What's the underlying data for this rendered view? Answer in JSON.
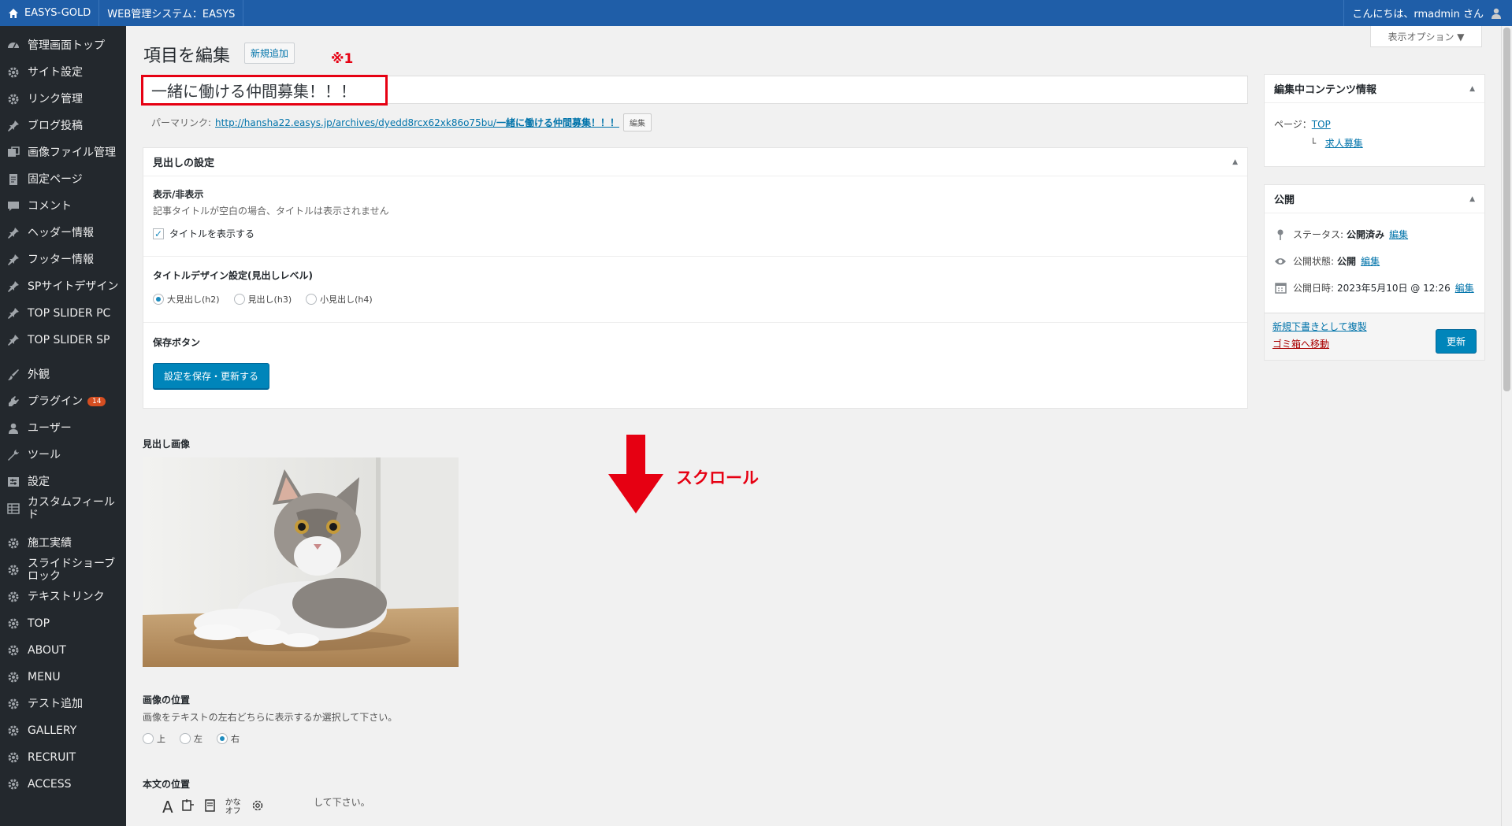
{
  "adminbar": {
    "site_name": "EASYS-GOLD",
    "system_name": "WEB管理システム：EASYS",
    "greeting": "こんにちは、rmadmin さん"
  },
  "sidebar": {
    "items": [
      {
        "label": "管理画面トップ",
        "icon": "dashboard-icon"
      },
      {
        "label": "サイト設定",
        "icon": "gear-icon"
      },
      {
        "label": "リンク管理",
        "icon": "gear-icon"
      },
      {
        "label": "ブログ投稿",
        "icon": "pin-icon"
      },
      {
        "label": "画像ファイル管理",
        "icon": "media-icon"
      },
      {
        "label": "固定ページ",
        "icon": "page-icon"
      },
      {
        "label": "コメント",
        "icon": "comment-icon"
      },
      {
        "label": "ヘッダー情報",
        "icon": "pin-icon"
      },
      {
        "label": "フッター情報",
        "icon": "pin-icon"
      },
      {
        "label": "SPサイトデザイン",
        "icon": "pin-icon"
      },
      {
        "label": "TOP SLIDER PC",
        "icon": "pin-icon"
      },
      {
        "label": "TOP SLIDER SP",
        "icon": "pin-icon"
      },
      {
        "label": "外観",
        "icon": "brush-icon"
      },
      {
        "label": "プラグイン",
        "icon": "plugin-icon",
        "badge": "14"
      },
      {
        "label": "ユーザー",
        "icon": "user-icon"
      },
      {
        "label": "ツール",
        "icon": "wrench-icon"
      },
      {
        "label": "設定",
        "icon": "settings-icon"
      },
      {
        "label": "カスタムフィールド",
        "icon": "table-icon"
      },
      {
        "label": "施工実績",
        "icon": "gear-icon"
      },
      {
        "label": "スライドショーブロック",
        "icon": "gear-icon"
      },
      {
        "label": "テキストリンク",
        "icon": "gear-icon"
      },
      {
        "label": "TOP",
        "icon": "gear-icon"
      },
      {
        "label": "ABOUT",
        "icon": "gear-icon"
      },
      {
        "label": "MENU",
        "icon": "gear-icon"
      },
      {
        "label": "テスト追加",
        "icon": "gear-icon"
      },
      {
        "label": "GALLERY",
        "icon": "gear-icon"
      },
      {
        "label": "RECRUIT",
        "icon": "gear-icon"
      },
      {
        "label": "ACCESS",
        "icon": "gear-icon"
      }
    ]
  },
  "page": {
    "title": "項目を編集",
    "add_new": "新規追加",
    "screen_options": "表示オプション ▼",
    "annotation_1": "※1",
    "post_title": "一緒に働ける仲間募集！！！",
    "permalink_label": "パーマリンク:",
    "permalink_url": "http://hansha22.easys.jp/archives/dyedd8rcx62xk86o75bu/",
    "permalink_slug": "一緒に働ける仲間募集！！！",
    "permalink_edit": "編集"
  },
  "heading_box": {
    "title": "見出しの設定",
    "display_label": "表示/非表示",
    "display_desc": "記事タイトルが空白の場合、タイトルは表示されません",
    "show_title_label": "タイトルを表示する",
    "show_title_checked": true,
    "design_label": "タイトルデザイン設定(見出しレベル)",
    "design_options": [
      "大見出し(h2)",
      "見出し(h3)",
      "小見出し(h4)"
    ],
    "design_selected": 0,
    "save_label": "保存ボタン",
    "save_button": "設定を保存・更新する"
  },
  "image_section": {
    "label": "見出し画像",
    "position_label": "画像の位置",
    "position_desc": "画像をテキストの左右どちらに表示するか選択して下さい。",
    "position_options": [
      "上",
      "左",
      "右"
    ],
    "position_selected": 2,
    "body_label": "本文の位置",
    "body_desc_fragment": "して下さい。"
  },
  "scroll_note": "スクロール",
  "ime_toolbar": [
    "A",
    "かな オフ"
  ],
  "info_box": {
    "title": "編集中コンテンツ情報",
    "page_label": "ページ：",
    "page_link": "TOP",
    "child_link": "求人募集"
  },
  "publish_box": {
    "title": "公開",
    "status_label": "ステータス:",
    "status_value": "公開済み",
    "visibility_label": "公開状態:",
    "visibility_value": "公開",
    "date_label": "公開日時:",
    "date_value": "2023年5月10日 @ 12:26",
    "edit": "編集",
    "copy_link": "新規下書きとして複製",
    "trash_link": "ゴミ箱へ移動",
    "update_button": "更新"
  },
  "colors": {
    "adminbar": "#1f5ea8",
    "sidebar": "#23282d",
    "primary": "#0085ba",
    "annotation": "#e60012"
  }
}
